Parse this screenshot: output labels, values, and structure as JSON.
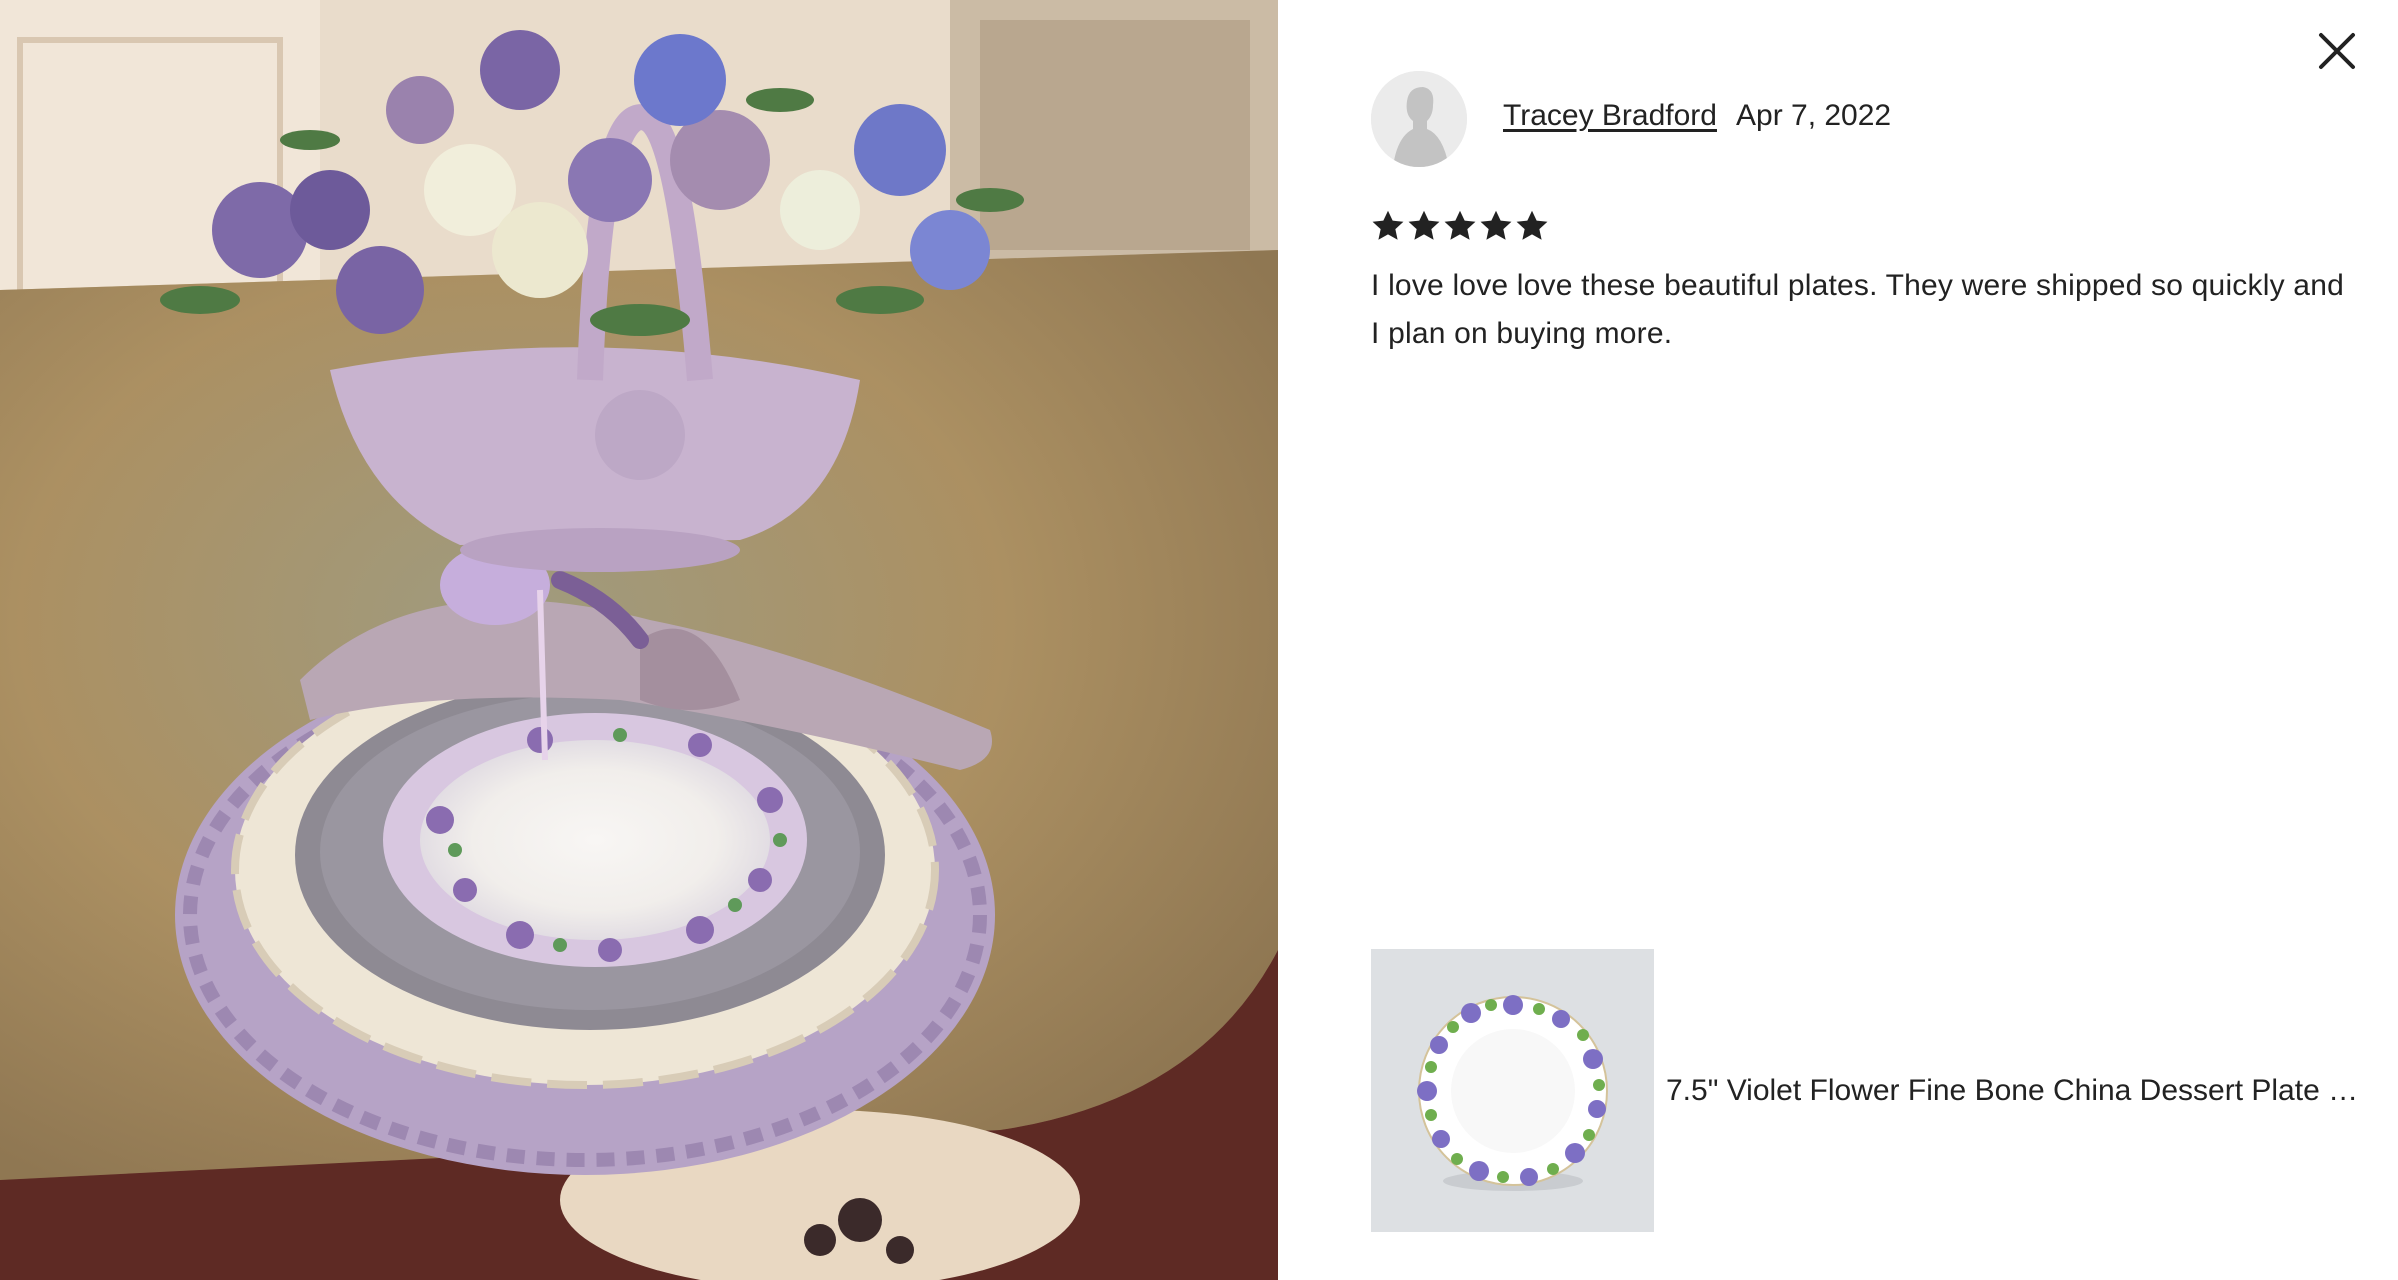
{
  "dialog": {
    "close_icon": "close-icon",
    "photo_description_icon": "review-photo"
  },
  "review": {
    "reviewer_name": "Tracey Bradford",
    "date": "Apr 7, 2022",
    "rating": 5,
    "rating_max": 5,
    "text": "I love love love these beautiful plates. They were shipped so quickly and I plan on buying more."
  },
  "product": {
    "title": "7.5\" Violet Flower Fine Bone China Dessert Plate Se..."
  },
  "colors": {
    "text": "#222222",
    "star": "#222222",
    "thumb_bg": "#dde0e3",
    "avatar_bg": "#ebebeb"
  }
}
